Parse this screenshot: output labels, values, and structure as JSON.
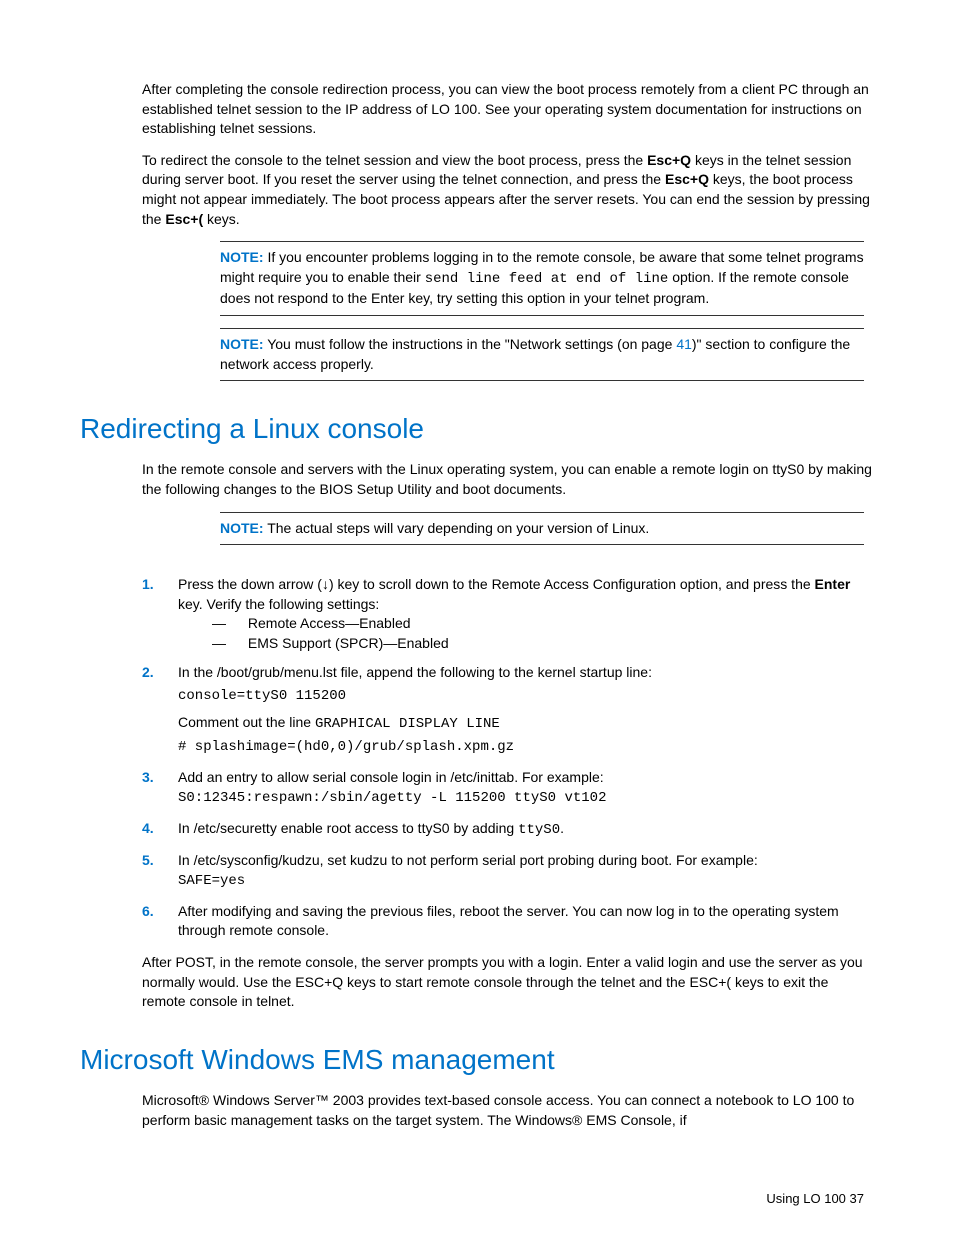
{
  "p1": "After completing the console redirection process, you can view the boot process remotely from a client PC through an established telnet session to the IP address of LO 100. See your operating system documentation for instructions on establishing telnet sessions.",
  "p2a": "To redirect the console to the telnet session and view the boot process, press the ",
  "p2b": "Esc+Q",
  "p2c": " keys in the telnet session during server boot. If you reset the server using the telnet connection, and press the ",
  "p2d": "Esc+Q",
  "p2e": " keys, the boot process might not appear immediately. The boot process appears after the server resets. You can end the session by pressing the ",
  "p2f": "Esc+(",
  "p2g": " keys.",
  "note1_label": "NOTE:",
  "note1a": "  If you encounter problems logging in to the remote console, be aware that some telnet programs might require you to enable their ",
  "note1b": "send line feed at end of line",
  "note1c": " option. If the remote console does not respond to the Enter key, try setting this option in your telnet program.",
  "note2_label": "NOTE:",
  "note2a": "  You must follow the instructions in the \"Network settings (on page ",
  "note2b": "41",
  "note2c": ")\" section to configure the network access properly.",
  "h1": "Redirecting a Linux console",
  "p3": "In the remote console and servers with the Linux operating system, you can enable a remote login on ttyS0 by making the following changes to the BIOS Setup Utility and boot documents.",
  "note3_label": "NOTE:",
  "note3a": "  The actual steps will vary depending on your version of Linux.",
  "step1_num": "1.",
  "step1a": "Press the down arrow (↓) key to scroll down to the Remote Access Configuration option, and press the ",
  "step1b": "Enter",
  "step1c": " key. Verify the following settings:",
  "step1_sub1_dash": "—",
  "step1_sub1": " Remote Access—Enabled",
  "step1_sub2_dash": "—",
  "step1_sub2": " EMS Support (SPCR)—Enabled",
  "step2_num": "2.",
  "step2a": "In the /boot/grub/menu.lst file, append the following to the kernel startup line:",
  "step2b": "console=ttyS0 115200",
  "step2c": "Comment out the line ",
  "step2d": "GRAPHICAL DISPLAY LINE",
  "step2e": "# splashimage=(hd0,0)/grub/splash.xpm.gz",
  "step3_num": "3.",
  "step3a": "Add an entry to allow serial console login in /etc/inittab. For example:",
  "step3b": "S0:12345:respawn:/sbin/agetty -L 115200 ttyS0 vt102",
  "step4_num": "4.",
  "step4a": "In /etc/securetty enable root access to ttyS0 by adding ",
  "step4b": "ttyS0",
  "step4c": ".",
  "step5_num": "5.",
  "step5a": "In /etc/sysconfig/kudzu, set kudzu to not perform serial port probing during boot. For example:",
  "step5b": "SAFE=yes",
  "step6_num": "6.",
  "step6a": "After modifying and saving the previous files, reboot the server. You can now log in to the operating system through remote console.",
  "p4": "After POST, in the remote console, the server prompts you with a login. Enter a valid login and use the server as you normally would. Use the ESC+Q keys to start remote console through the telnet and the ESC+( keys to exit the remote console in telnet.",
  "h2": "Microsoft Windows EMS management",
  "p5": "Microsoft® Windows Server™ 2003 provides text-based console access. You can connect a notebook to LO 100 to perform basic management tasks on the target system. The Windows® EMS Console, if",
  "footer": "Using LO 100   37"
}
